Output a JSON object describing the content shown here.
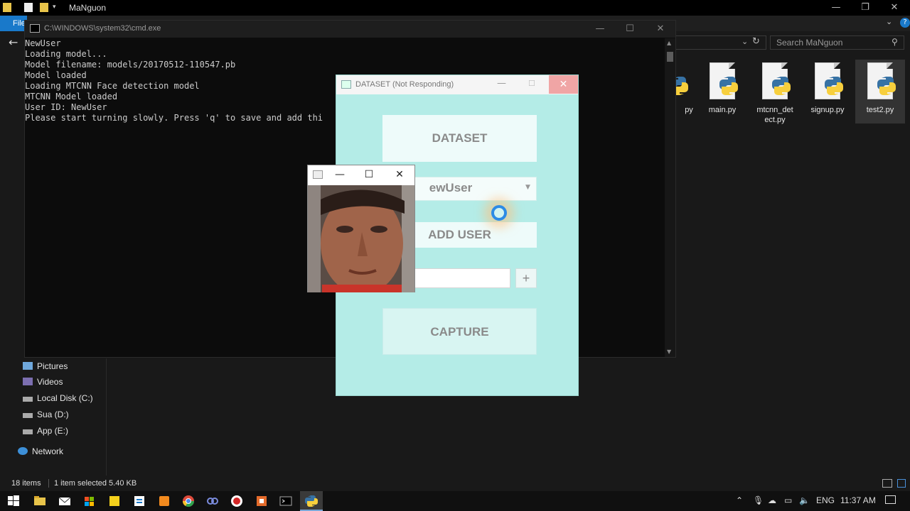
{
  "explorer": {
    "title": "MaNguon",
    "file_tab": "File",
    "search_placeholder": "Search MaNguon",
    "files": [
      {
        "name": "py"
      },
      {
        "name": "main.py"
      },
      {
        "name": "mtcnn_det\nect.py"
      },
      {
        "name": "signup.py"
      },
      {
        "name": "test2.py"
      }
    ],
    "nav": [
      "Pictures",
      "Videos",
      "Local Disk (C:)",
      "Sua (D:)",
      "App (E:)",
      "Network"
    ],
    "status": {
      "items": "18 items",
      "selected": "1 item selected  5.40 KB"
    }
  },
  "cmd": {
    "title": "C:\\WINDOWS\\system32\\cmd.exe",
    "lines": [
      "NewUser",
      "Loading model...",
      "Model filename: models/20170512-110547.pb",
      "Model loaded",
      "Loading MTCNN Face detection model",
      "MTCNN Model loaded",
      "User ID: NewUser",
      "Please start turning slowly. Press 'q' to save and add thi"
    ]
  },
  "dataset_app": {
    "title": "DATASET (Not Responding)",
    "dataset_label": "DATASET",
    "combo_value": "ewUser",
    "add_user_label": "ADD USER",
    "plus_label": "+",
    "capture_label": "CAPTURE"
  },
  "taskbar": {
    "language": "ENG",
    "clock": "11:37 AM"
  },
  "colors": {
    "dataset_bg": "#b4ece7",
    "accent_blue": "#1979ca",
    "close_red": "#f0a5a5"
  }
}
